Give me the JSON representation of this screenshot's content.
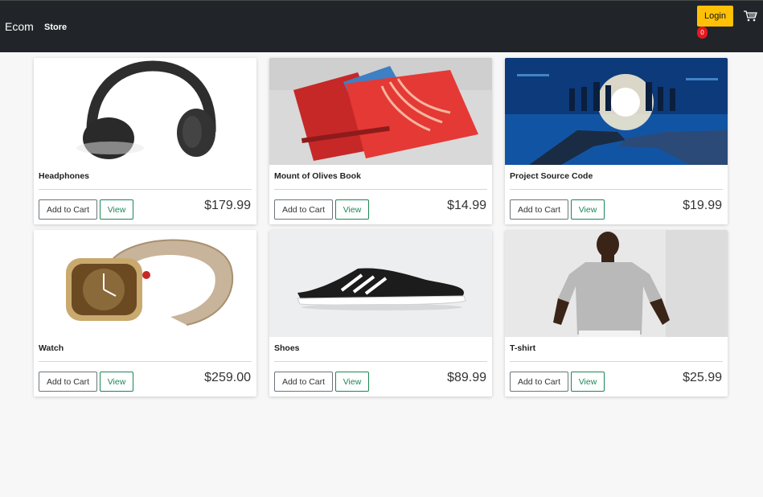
{
  "navbar": {
    "brand": "Ecom",
    "links": [
      "Store"
    ],
    "login_label": "Login",
    "cart_count": "0",
    "cart_icon": "cart-icon"
  },
  "products": [
    {
      "title": "Headphones",
      "price": "$179.99",
      "add_label": "Add to Cart",
      "view_label": "View",
      "image": "headphones-image"
    },
    {
      "title": "Mount of Olives Book",
      "price": "$14.99",
      "add_label": "Add to Cart",
      "view_label": "View",
      "image": "book-image"
    },
    {
      "title": "Project Source Code",
      "price": "$19.99",
      "add_label": "Add to Cart",
      "view_label": "View",
      "image": "business-handshake-image"
    },
    {
      "title": "Watch",
      "price": "$259.00",
      "add_label": "Add to Cart",
      "view_label": "View",
      "image": "watch-image"
    },
    {
      "title": "Shoes",
      "price": "$89.99",
      "add_label": "Add to Cart",
      "view_label": "View",
      "image": "shoes-image"
    },
    {
      "title": "T-shirt",
      "price": "$25.99",
      "add_label": "Add to Cart",
      "view_label": "View",
      "image": "tshirt-image"
    }
  ],
  "colors": {
    "navbar_bg": "#212529",
    "login_bg": "#ffc107",
    "badge_bg": "#e8171f",
    "view_accent": "#198754",
    "page_bg": "#f7f7f7"
  }
}
